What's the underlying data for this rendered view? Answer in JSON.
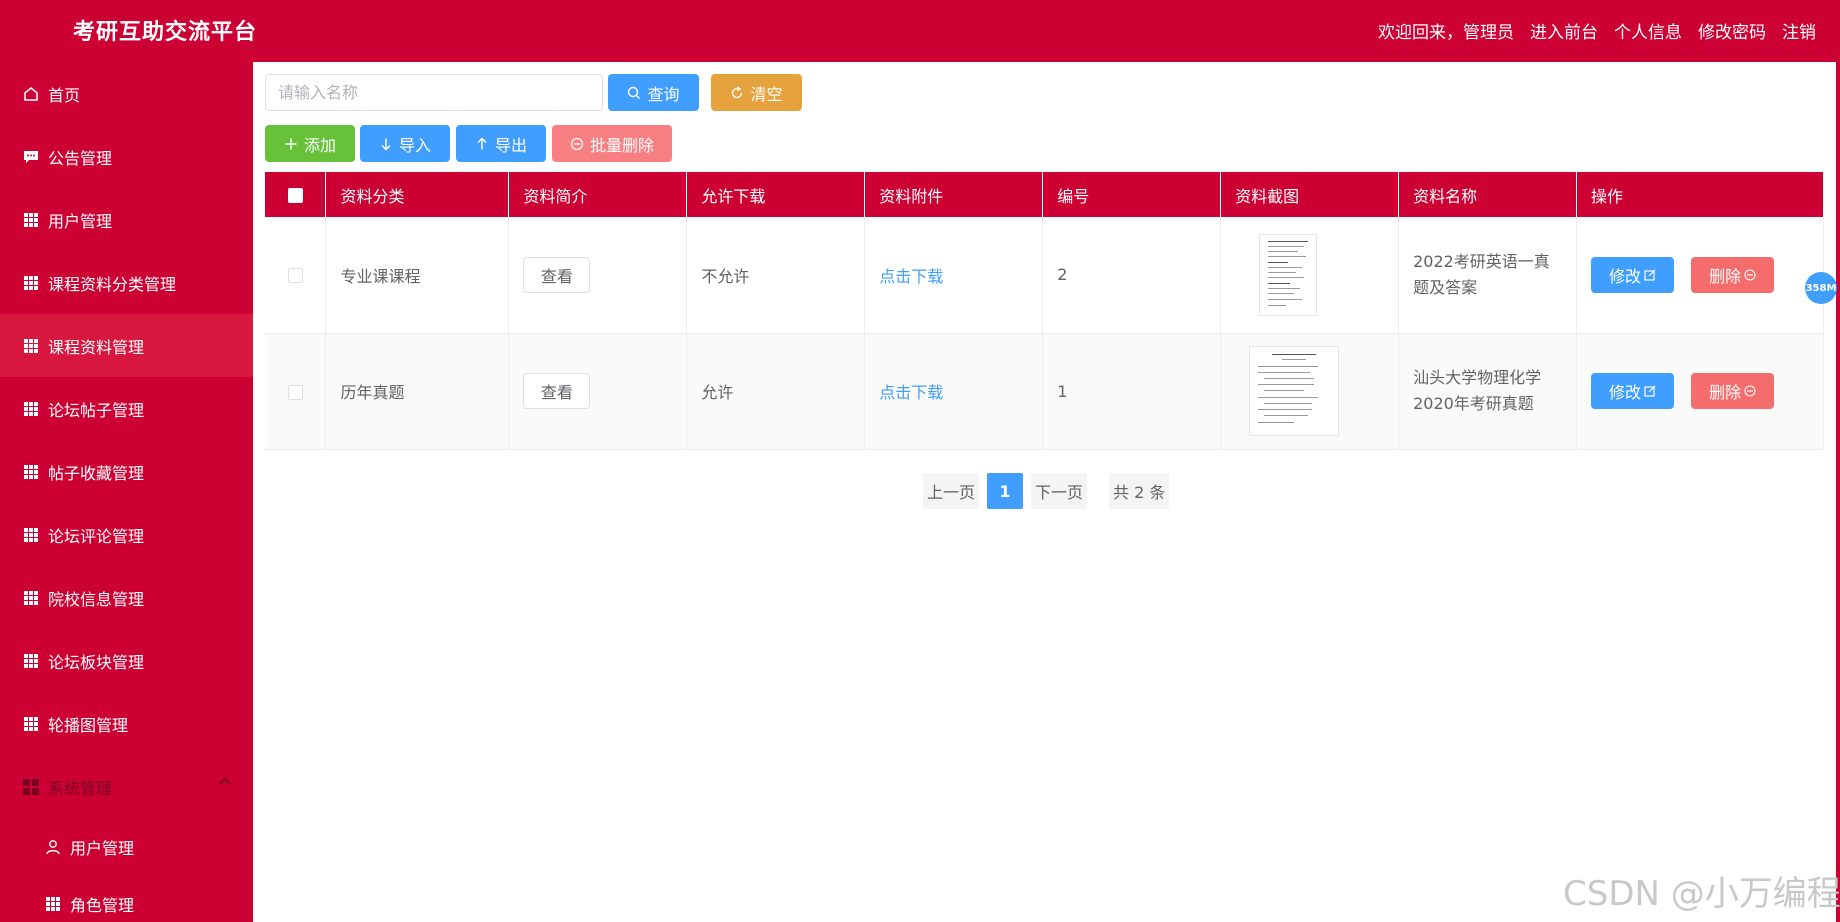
{
  "header": {
    "title": "考研互助交流平台",
    "welcome": "欢迎回来，管理员",
    "links": [
      "进入前台",
      "个人信息",
      "修改密码",
      "注销"
    ]
  },
  "sidebar": {
    "items": [
      {
        "label": "首页",
        "icon": "home-icon"
      },
      {
        "label": "公告管理",
        "icon": "message-icon"
      },
      {
        "label": "用户管理",
        "icon": "grid-icon"
      },
      {
        "label": "课程资料分类管理",
        "icon": "grid-icon"
      },
      {
        "label": "课程资料管理",
        "icon": "grid-icon",
        "active": true
      },
      {
        "label": "论坛帖子管理",
        "icon": "grid-icon"
      },
      {
        "label": "帖子收藏管理",
        "icon": "grid-icon"
      },
      {
        "label": "论坛评论管理",
        "icon": "grid-icon"
      },
      {
        "label": "院校信息管理",
        "icon": "grid-icon"
      },
      {
        "label": "论坛板块管理",
        "icon": "grid-icon"
      },
      {
        "label": "轮播图管理",
        "icon": "grid-icon"
      }
    ],
    "group": {
      "label": "系统管理",
      "expanded": true
    },
    "sub_items": [
      {
        "label": "用户管理",
        "icon": "user-icon"
      },
      {
        "label": "角色管理",
        "icon": "grid-icon"
      }
    ]
  },
  "search": {
    "placeholder": "请输入名称",
    "query_label": "查询",
    "clear_label": "清空"
  },
  "toolbar": {
    "add_label": "添加",
    "import_label": "导入",
    "export_label": "导出",
    "batch_delete_label": "批量删除"
  },
  "table": {
    "columns": [
      "资料分类",
      "资料简介",
      "允许下载",
      "资料附件",
      "编号",
      "资料截图",
      "资料名称",
      "操作"
    ],
    "rows": [
      {
        "category": "专业课课程",
        "intro_btn": "查看",
        "download": "不允许",
        "attachment": "点击下载",
        "number": "2",
        "name": "2022考研英语一真题及答案",
        "edit": "修改",
        "delete": "删除"
      },
      {
        "category": "历年真题",
        "intro_btn": "查看",
        "download": "允许",
        "attachment": "点击下载",
        "number": "1",
        "name": "汕头大学物理化学2020年考研真题",
        "edit": "修改",
        "delete": "删除"
      }
    ]
  },
  "pagination": {
    "prev": "上一页",
    "current": "1",
    "next": "下一页",
    "total": "共 2 条"
  },
  "float_badge": "358M",
  "watermark": "CSDN @小万编程",
  "colors": {
    "brand": "#cc0033",
    "primary": "#409eff",
    "warning": "#e6a23c",
    "success": "#67c23a",
    "danger": "#f56c6c"
  }
}
